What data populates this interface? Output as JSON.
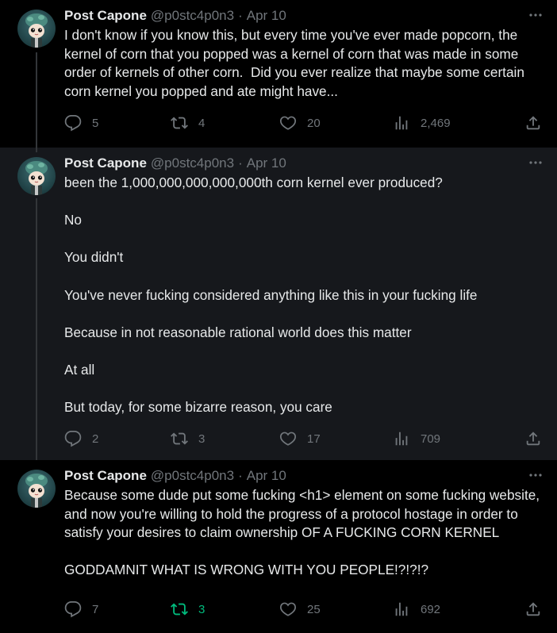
{
  "tweets": [
    {
      "author": {
        "name": "Post Capone",
        "handle": "@p0stc4p0n3"
      },
      "date": "Apr 10",
      "text": "I don't know if you know this, but every time you've ever made popcorn, the kernel of corn that you popped was a kernel of corn that was made in some order of kernels of other corn.  Did you ever realize that maybe some certain corn kernel you popped and ate might have...",
      "stats": {
        "replies": "5",
        "retweets": "4",
        "likes": "20",
        "views": "2,469"
      }
    },
    {
      "author": {
        "name": "Post Capone",
        "handle": "@p0stc4p0n3"
      },
      "date": "Apr 10",
      "text": "been the 1,000,000,000,000,000th corn kernel ever produced?\n\nNo\n\nYou didn't\n\nYou've never fucking considered anything like this in your fucking life\n\nBecause in not reasonable rational world does this matter\n\nAt all\n\nBut today, for some bizarre reason, you care",
      "stats": {
        "replies": "2",
        "retweets": "3",
        "likes": "17",
        "views": "709"
      }
    },
    {
      "author": {
        "name": "Post Capone",
        "handle": "@p0stc4p0n3"
      },
      "date": "Apr 10",
      "text": "Because some dude put some fucking <h1> element on some fucking website, and now you're willing to hold the progress of a protocol hostage in order to satisfy your desires to claim ownership OF A FUCKING CORN KERNEL\n\nGODDAMNIT WHAT IS WRONG WITH YOU PEOPLE!?!?!?",
      "stats": {
        "replies": "7",
        "retweets": "3",
        "likes": "25",
        "views": "692"
      }
    }
  ],
  "colors": {
    "text": "#e7e9ea",
    "muted": "#71767b",
    "retweet_active": "#00ba7c",
    "highlight_bg": "#16181c"
  },
  "icons": [
    "reply-icon",
    "retweet-icon",
    "like-icon",
    "views-icon",
    "share-icon",
    "more-icon"
  ]
}
